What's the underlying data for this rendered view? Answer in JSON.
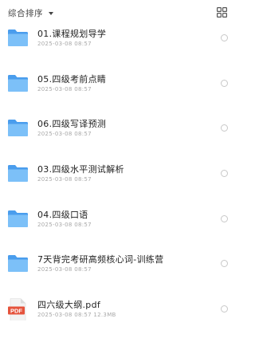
{
  "toolbar": {
    "sort_label": "综合排序",
    "caret_icon": "caret-down-icon",
    "view_toggle_icon": "grid-view-icon"
  },
  "colors": {
    "folder_back": "#4a9ded",
    "folder_front": "#7cc0f8",
    "pdf_red": "#e5533c"
  },
  "files": [
    {
      "type": "folder",
      "icon": "folder-icon",
      "name": "01.课程规划导学",
      "meta": "2025-03-08 08:57"
    },
    {
      "type": "folder",
      "icon": "folder-icon",
      "name": "05.四级考前点睛",
      "meta": "2025-03-08 08:57"
    },
    {
      "type": "folder",
      "icon": "folder-icon",
      "name": "06.四级写译预测",
      "meta": "2025-03-08 08:57"
    },
    {
      "type": "folder",
      "icon": "folder-icon",
      "name": "03.四级水平测试解析",
      "meta": "2025-03-08 08:57"
    },
    {
      "type": "folder",
      "icon": "folder-icon",
      "name": "04.四级口语",
      "meta": "2025-03-08 08:57"
    },
    {
      "type": "folder",
      "icon": "folder-icon",
      "name": "7天背完考研高频核心词-训练营",
      "meta": "2025-03-08 08:57"
    },
    {
      "type": "pdf",
      "icon": "pdf-file-icon",
      "icon_label": "PDF",
      "name": "四六级大纲.pdf",
      "meta": "2025-03-08 08:57 12.3MB"
    }
  ]
}
